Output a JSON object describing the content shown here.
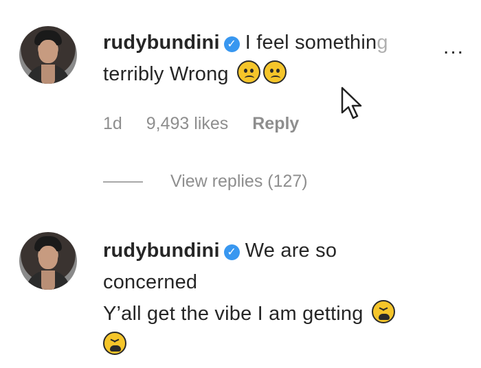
{
  "comments": [
    {
      "username": "rudybundini",
      "verified_icon": "blue-check-icon",
      "line1_visible": "I feel somethin",
      "line1_fade": "g",
      "line2": "terribly Wrong",
      "emojis": [
        "worried-face-icon",
        "worried-face-icon"
      ],
      "more_label": "...",
      "time": "1d",
      "likes": "9,493 likes",
      "reply_label": "Reply",
      "view_replies": "View replies (127)"
    },
    {
      "username": "rudybundini",
      "verified_icon": "blue-check-icon",
      "line1": "We are so",
      "line2": "concerned",
      "line3": "Y’all get the vibe I am getting",
      "emojis": [
        "tired-face-icon",
        "tired-face-icon"
      ]
    }
  ],
  "colors": {
    "text": "#262626",
    "meta": "#8e8e8e",
    "verified": "#3897f0",
    "emoji": "#f5c52a"
  }
}
